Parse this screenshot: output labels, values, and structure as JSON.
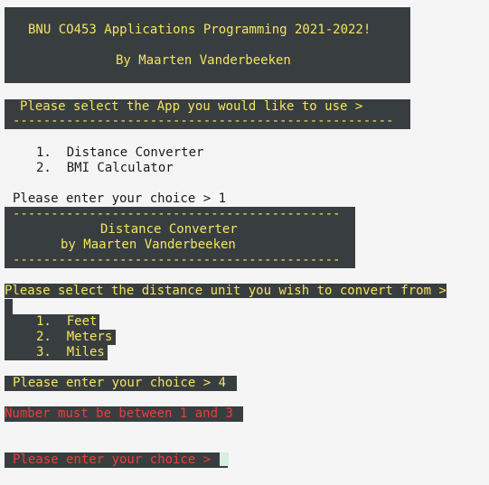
{
  "banner": {
    "title": "BNU CO453 Applications Programming 2021-2022!",
    "author": "By Maarten Vanderbeeken"
  },
  "app_prompt": {
    "text": "Please select the App you would like to use >",
    "dashes": "--------------------------------------------------"
  },
  "app_menu": {
    "items": [
      {
        "number": "1.",
        "label": "Distance Converter"
      },
      {
        "number": "2.",
        "label": "BMI Calculator"
      }
    ]
  },
  "first_choice": {
    "prompt": "Please enter your choice >",
    "value": "1"
  },
  "converter_header": {
    "dashes_top": "-------------------------------------------",
    "title": "Distance Converter",
    "author": "by Maarten Vanderbeeken",
    "dashes_bottom": "-------------------------------------------"
  },
  "unit_prompt": {
    "text": "Please select the distance unit you wish to convert from >"
  },
  "unit_menu": {
    "items": [
      {
        "number": "1.",
        "label": "Feet"
      },
      {
        "number": "2.",
        "label": "Meters"
      },
      {
        "number": "3.",
        "label": "Miles"
      }
    ]
  },
  "second_choice": {
    "prompt": "Please enter your choice >",
    "value": "4"
  },
  "error": {
    "message": "Number must be between 1 and 3"
  },
  "third_choice": {
    "prompt": "Please enter your choice >",
    "value": ""
  },
  "colors": {
    "background": "#f5f5f5",
    "panel": "#383e40",
    "yellow_text": "#f4e45e",
    "red_text": "#ef3c3c",
    "cursor": "#d7eee1"
  }
}
